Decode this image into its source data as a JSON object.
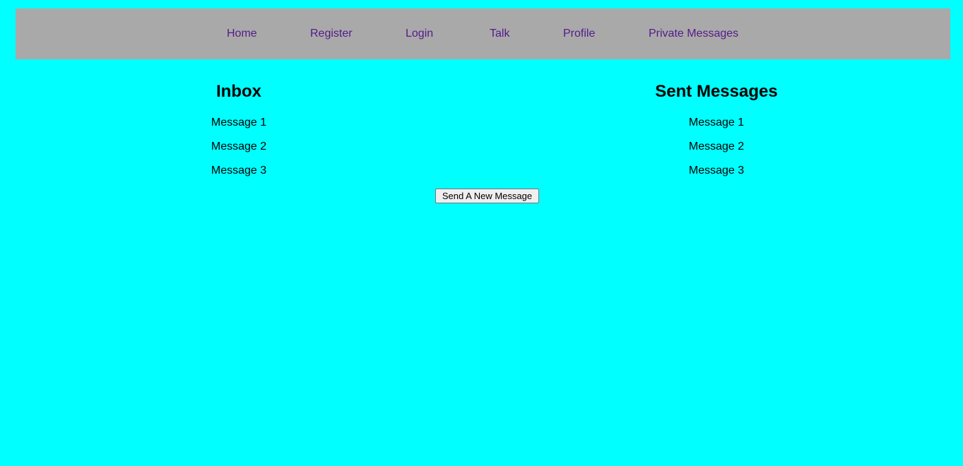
{
  "nav": {
    "links": [
      {
        "label": "Home"
      },
      {
        "label": "Register"
      },
      {
        "label": "Login"
      },
      {
        "label": "Talk"
      },
      {
        "label": "Profile"
      },
      {
        "label": "Private Messages"
      }
    ]
  },
  "inbox": {
    "title": "Inbox",
    "messages": [
      "Message 1",
      "Message 2",
      "Message 3"
    ]
  },
  "sent": {
    "title": "Sent Messages",
    "messages": [
      "Message 1",
      "Message 2",
      "Message 3"
    ]
  },
  "actions": {
    "send_new_label": "Send A New Message"
  },
  "colors": {
    "background": "#00ffff",
    "navbar": "#a9a9a9",
    "link": "#551a8b"
  }
}
